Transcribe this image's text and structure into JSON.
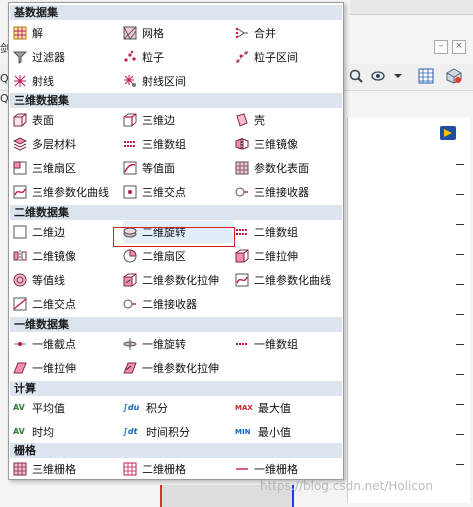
{
  "menu": {
    "sections": [
      {
        "title": "基数据集",
        "items": [
          {
            "label": "解",
            "icon": "solution-icon"
          },
          {
            "label": "网格",
            "icon": "mesh-icon"
          },
          {
            "label": "合并",
            "icon": "join-icon"
          },
          {
            "label": "过滤器",
            "icon": "filter-icon"
          },
          {
            "label": "粒子",
            "icon": "particle-icon"
          },
          {
            "label": "粒子区间",
            "icon": "particle-bin-icon"
          },
          {
            "label": "射线",
            "icon": "ray-icon"
          },
          {
            "label": "射线区间",
            "icon": "ray-bin-icon"
          }
        ]
      },
      {
        "title": "三维数据集",
        "items": [
          {
            "label": "表面",
            "icon": "surface-icon"
          },
          {
            "label": "三维边",
            "icon": "edge-3d-icon"
          },
          {
            "label": "壳",
            "icon": "shell-icon"
          },
          {
            "label": "多层材料",
            "icon": "layered-material-icon"
          },
          {
            "label": "三维数组",
            "icon": "array-3d-icon"
          },
          {
            "label": "三维镜像",
            "icon": "mirror-3d-icon"
          },
          {
            "label": "三维扇区",
            "icon": "sector-3d-icon"
          },
          {
            "label": "等值面",
            "icon": "isosurface-icon"
          },
          {
            "label": "参数化表面",
            "icon": "parametric-surface-icon"
          },
          {
            "label": "三维参数化曲线",
            "icon": "parametric-curve-3d-icon"
          },
          {
            "label": "三维交点",
            "icon": "intersection-3d-icon"
          },
          {
            "label": "三维接收器",
            "icon": "receiver-3d-icon"
          }
        ]
      },
      {
        "title": "二维数据集",
        "items": [
          {
            "label": "二维边",
            "icon": "edge-2d-icon"
          },
          {
            "label": "二维旋转",
            "icon": "revolution-2d-icon"
          },
          {
            "label": "二维数组",
            "icon": "array-2d-icon"
          },
          {
            "label": "二维镜像",
            "icon": "mirror-2d-icon"
          },
          {
            "label": "二维扇区",
            "icon": "sector-2d-icon"
          },
          {
            "label": "二维拉伸",
            "icon": "extrusion-2d-icon"
          },
          {
            "label": "等值线",
            "icon": "isoline-icon"
          },
          {
            "label": "二维参数化拉伸",
            "icon": "parametric-extrusion-2d-icon"
          },
          {
            "label": "二维参数化曲线",
            "icon": "parametric-curve-2d-icon"
          },
          {
            "label": "二维交点",
            "icon": "intersection-2d-icon"
          },
          {
            "label": "二维接收器",
            "icon": "receiver-2d-icon"
          }
        ]
      },
      {
        "title": "一维数据集",
        "items": [
          {
            "label": "一维截点",
            "icon": "cut-point-1d-icon"
          },
          {
            "label": "一维旋转",
            "icon": "revolution-1d-icon"
          },
          {
            "label": "一维数组",
            "icon": "array-1d-icon"
          },
          {
            "label": "一维拉伸",
            "icon": "extrusion-1d-icon"
          },
          {
            "label": "一维参数化拉伸",
            "icon": "parametric-extrusion-1d-icon"
          }
        ]
      },
      {
        "title": "计算",
        "items": [
          {
            "label": "平均值",
            "icon": "average-icon",
            "glyph": "AV"
          },
          {
            "label": "积分",
            "icon": "integration-icon",
            "glyph": "∫du"
          },
          {
            "label": "最大值",
            "icon": "maximum-icon",
            "glyph": "MAX"
          },
          {
            "label": "时均",
            "icon": "time-average-icon",
            "glyph": "AV"
          },
          {
            "label": "时间积分",
            "icon": "time-integration-icon",
            "glyph": "∫dt"
          },
          {
            "label": "最小值",
            "icon": "minimum-icon",
            "glyph": "MIN"
          }
        ]
      },
      {
        "title": "栅格",
        "items": [
          {
            "label": "三维栅格",
            "icon": "grid-3d-icon"
          },
          {
            "label": "二维栅格",
            "icon": "grid-2d-icon"
          },
          {
            "label": "一维栅格",
            "icon": "grid-1d-icon"
          }
        ]
      }
    ],
    "highlighted": "二维旋转"
  },
  "background": {
    "left_glyphs": [
      "剑",
      "Q",
      "Q"
    ],
    "watermark": "https://blog.csdn.net/Holicon"
  },
  "colors": {
    "accent": "#c2185b",
    "section_bg": "#dbe4ef",
    "highlight_bg": "#e2effb",
    "selection_border": "#d81e1e"
  }
}
